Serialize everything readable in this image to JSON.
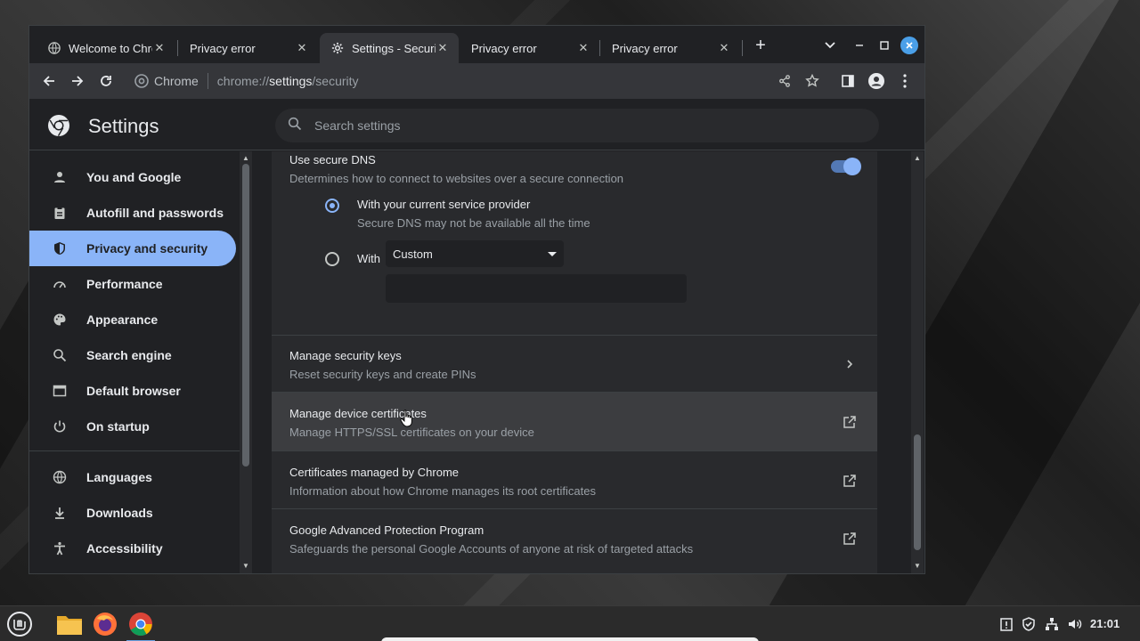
{
  "browser": {
    "tabs": [
      {
        "title": "Welcome to Chrome",
        "active": false
      },
      {
        "title": "Privacy error",
        "active": false
      },
      {
        "title": "Settings - Security",
        "active": true
      },
      {
        "title": "Privacy error",
        "active": false
      },
      {
        "title": "Privacy error",
        "active": false
      }
    ],
    "omnibox": {
      "chip": "Chrome",
      "url_prefix": "chrome://",
      "url_host": "settings",
      "url_path": "/security"
    }
  },
  "settings": {
    "title": "Settings",
    "search_placeholder": "Search settings",
    "nav": [
      {
        "label": "You and Google",
        "icon": "person-icon"
      },
      {
        "label": "Autofill and passwords",
        "icon": "clipboard-icon"
      },
      {
        "label": "Privacy and security",
        "icon": "shield-icon",
        "active": true
      },
      {
        "label": "Performance",
        "icon": "speedometer-icon"
      },
      {
        "label": "Appearance",
        "icon": "palette-icon"
      },
      {
        "label": "Search engine",
        "icon": "search-icon"
      },
      {
        "label": "Default browser",
        "icon": "browser-icon"
      },
      {
        "label": "On startup",
        "icon": "power-icon"
      },
      {
        "label": "Languages",
        "icon": "globe-icon"
      },
      {
        "label": "Downloads",
        "icon": "download-icon"
      },
      {
        "label": "Accessibility",
        "icon": "accessibility-icon"
      }
    ],
    "secure_dns": {
      "title": "Use secure DNS",
      "subtitle": "Determines how to connect to websites over a secure connection",
      "enabled": true,
      "option_current": {
        "title": "With your current service provider",
        "subtitle": "Secure DNS may not be available all the time",
        "selected": true
      },
      "option_custom": {
        "label": "With",
        "selected_value": "Custom",
        "input_value": ""
      }
    },
    "rows": [
      {
        "title": "Manage security keys",
        "subtitle": "Reset security keys and create PINs",
        "trail": "chevron-right-icon"
      },
      {
        "title": "Manage device certificates",
        "subtitle": "Manage HTTPS/SSL certificates on your device",
        "trail": "open-in-new-icon"
      },
      {
        "title": "Certificates managed by Chrome",
        "subtitle": "Information about how Chrome manages its root certificates",
        "trail": "open-in-new-icon"
      },
      {
        "title": "Google Advanced Protection Program",
        "subtitle": "Safeguards the personal Google Accounts of anyone at risk of targeted attacks",
        "trail": "open-in-new-icon"
      }
    ]
  },
  "taskbar": {
    "clock": "21:01",
    "apps": [
      "menu-icon",
      "files-icon",
      "firefox-icon",
      "chrome-icon"
    ],
    "tray": [
      "clipboard-tray-icon",
      "shield-tray-icon",
      "network-icon",
      "volume-icon"
    ]
  },
  "colors": {
    "accent": "#8ab4f8",
    "page_bg": "#202124",
    "card_bg": "#292a2d",
    "toolbar_bg": "#35363a"
  }
}
